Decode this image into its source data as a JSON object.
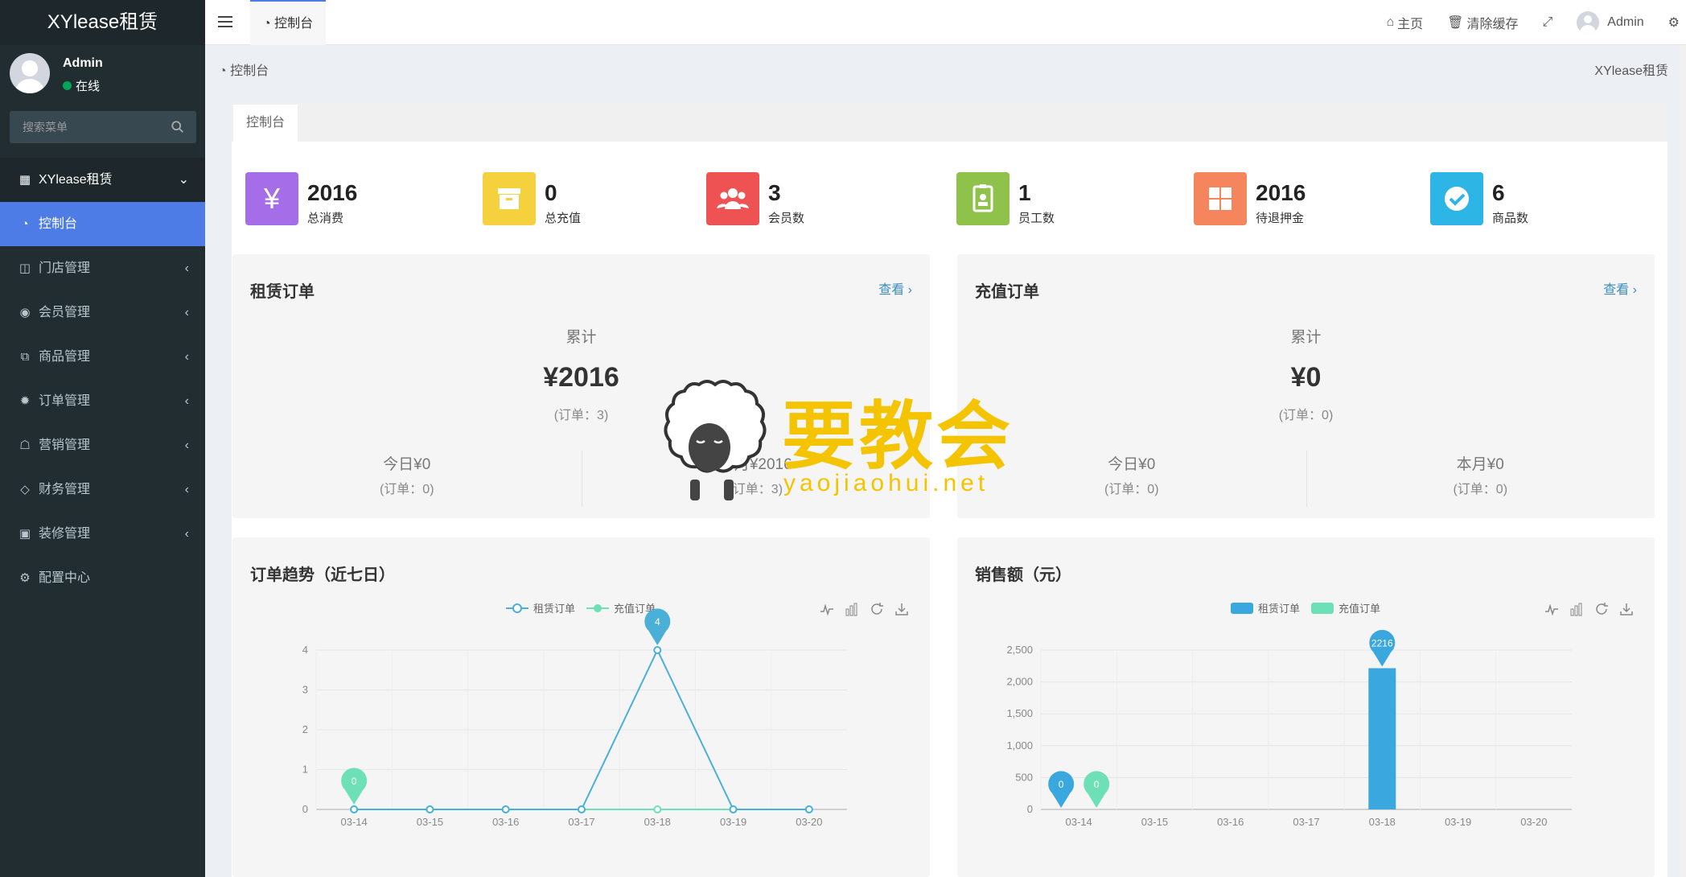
{
  "sidebar": {
    "logo": "XYlease租赁",
    "user": {
      "name": "Admin",
      "status": "在线"
    },
    "search": {
      "placeholder": "搜索菜单"
    },
    "menu": [
      {
        "label": "XYlease租赁",
        "icon": "grid-icon",
        "type": "header"
      },
      {
        "label": "控制台",
        "icon": "dashboard-icon",
        "type": "active"
      },
      {
        "label": "门店管理",
        "icon": "store-icon"
      },
      {
        "label": "会员管理",
        "icon": "user-icon"
      },
      {
        "label": "商品管理",
        "icon": "products-icon"
      },
      {
        "label": "订单管理",
        "icon": "gear-icon"
      },
      {
        "label": "营销管理",
        "icon": "marketing-icon"
      },
      {
        "label": "财务管理",
        "icon": "diamond-icon"
      },
      {
        "label": "装修管理",
        "icon": "photo-icon"
      },
      {
        "label": "配置中心",
        "icon": "settings-icon"
      }
    ]
  },
  "topbar": {
    "tab": "控制台",
    "home": "主页",
    "clear_cache": "清除缓存",
    "user": "Admin"
  },
  "breadcrumb": {
    "current": "控制台",
    "site": "XYlease租赁"
  },
  "panel_tab": "控制台",
  "stats": [
    {
      "value": "2016",
      "label": "总消费",
      "color": "#a56ee8",
      "icon": "yen-icon"
    },
    {
      "value": "0",
      "label": "总充值",
      "color": "#f5d13e",
      "icon": "archive-icon"
    },
    {
      "value": "3",
      "label": "会员数",
      "color": "#ee5252",
      "icon": "users-icon"
    },
    {
      "value": "1",
      "label": "员工数",
      "color": "#8fc24a",
      "icon": "badge-icon"
    },
    {
      "value": "2016",
      "label": "待退押金",
      "color": "#f5855c",
      "icon": "grid-icon"
    },
    {
      "value": "6",
      "label": "商品数",
      "color": "#2db5e6",
      "icon": "check-icon"
    }
  ],
  "lease_card": {
    "title": "租赁订单",
    "more": "查看 ›",
    "total_label": "累计",
    "total": "¥2016",
    "total_orders": "(订单：3)",
    "today": "今日¥0",
    "today_orders": "(订单：0)",
    "month": "本月¥2016",
    "month_orders": "(订单：3)"
  },
  "recharge_card": {
    "title": "充值订单",
    "more": "查看 ›",
    "total_label": "累计",
    "total": "¥0",
    "total_orders": "(订单：0)",
    "today": "今日¥0",
    "today_orders": "(订单：0)",
    "month": "本月¥0",
    "month_orders": "(订单：0)"
  },
  "watermark": {
    "text": "要教会",
    "url": "yaojiaohui.net"
  },
  "chart_data": [
    {
      "type": "line",
      "title": "订单趋势（近七日）",
      "categories": [
        "03-14",
        "03-15",
        "03-16",
        "03-17",
        "03-18",
        "03-19",
        "03-20"
      ],
      "series": [
        {
          "name": "租赁订单",
          "values": [
            0,
            0,
            0,
            0,
            4,
            0,
            0
          ],
          "color": "#4bb0d8"
        },
        {
          "name": "充值订单",
          "values": [
            0,
            0,
            0,
            0,
            0,
            0,
            0
          ],
          "color": "#6ee0b8"
        }
      ],
      "ylim": [
        0,
        4
      ],
      "yticks": [
        "0",
        "1",
        "2",
        "3",
        "4"
      ],
      "markers": [
        {
          "series": "租赁订单",
          "category": "03-18",
          "value": "4"
        },
        {
          "series": "充值订单",
          "category": "03-14",
          "value": "0"
        }
      ],
      "legend": "top-center",
      "grid": true
    },
    {
      "type": "bar",
      "title": "销售额（元）",
      "categories": [
        "03-14",
        "03-15",
        "03-16",
        "03-17",
        "03-18",
        "03-19",
        "03-20"
      ],
      "series": [
        {
          "name": "租赁订单",
          "values": [
            0,
            0,
            0,
            0,
            2216,
            0,
            0
          ],
          "color": "#3aa7df"
        },
        {
          "name": "充值订单",
          "values": [
            0,
            0,
            0,
            0,
            0,
            0,
            0
          ],
          "color": "#6ee0b8"
        }
      ],
      "ylim": [
        0,
        2500
      ],
      "yticks": [
        "0",
        "500",
        "1,000",
        "1,500",
        "2,000",
        "2,500"
      ],
      "markers": [
        {
          "series": "租赁订单",
          "category": "03-18",
          "value": "2216"
        },
        {
          "series": "租赁订单",
          "category": "03-14",
          "value": "0"
        },
        {
          "series": "充值订单",
          "category": "03-14",
          "value": "0"
        }
      ],
      "legend": "top-center",
      "grid": true
    }
  ]
}
